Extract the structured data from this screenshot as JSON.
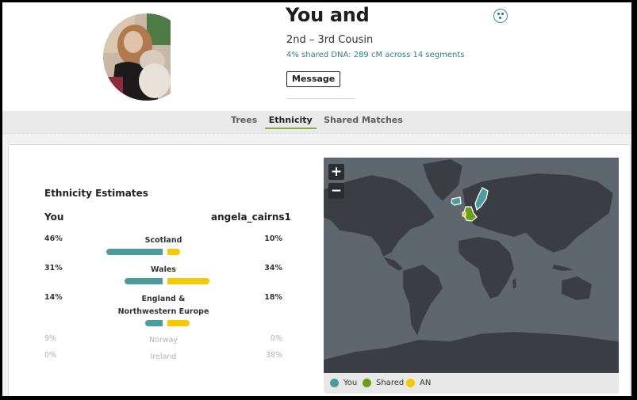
{
  "header": {
    "title": "You and",
    "relationship": "2nd – 3rd Cousin",
    "shared_dna": "4% shared DNA: 289 cM across 14 segments",
    "message_label": "Message",
    "tree_icon": "family-tree-icon"
  },
  "tabs": [
    {
      "label": "Trees",
      "active": false
    },
    {
      "label": "Ethnicity",
      "active": true
    },
    {
      "label": "Shared Matches",
      "active": false
    }
  ],
  "ethnicity": {
    "title": "Ethnicity Estimates",
    "col_you": "You",
    "col_match": "angela_cairns1",
    "rows": [
      {
        "region": "Scotland",
        "you": "46%",
        "match": "10%",
        "you_value": 46,
        "match_value": 10,
        "shared": true
      },
      {
        "region": "Wales",
        "you": "31%",
        "match": "34%",
        "you_value": 31,
        "match_value": 34,
        "shared": true
      },
      {
        "region": "England & Northwestern Europe",
        "you": "14%",
        "match": "18%",
        "you_value": 14,
        "match_value": 18,
        "shared": true
      },
      {
        "region": "Norway",
        "you": "9%",
        "match": "0%",
        "you_value": 9,
        "match_value": 0,
        "shared": false
      },
      {
        "region": "Ireland",
        "you": "0%",
        "match": "38%",
        "you_value": 0,
        "match_value": 38,
        "shared": false
      }
    ]
  },
  "map": {
    "zoom_in": "+",
    "zoom_out": "−",
    "legend": [
      {
        "label": "You",
        "color": "#4a9d9c"
      },
      {
        "label": "Shared",
        "color": "#6a9f1a"
      },
      {
        "label": "AN",
        "color": "#f7c900"
      }
    ]
  },
  "colors": {
    "you": "#4a9d9c",
    "match": "#f7c900",
    "shared": "#6a9f1a",
    "link": "#2c7f9a",
    "active_tab_underline": "#7db33b"
  }
}
